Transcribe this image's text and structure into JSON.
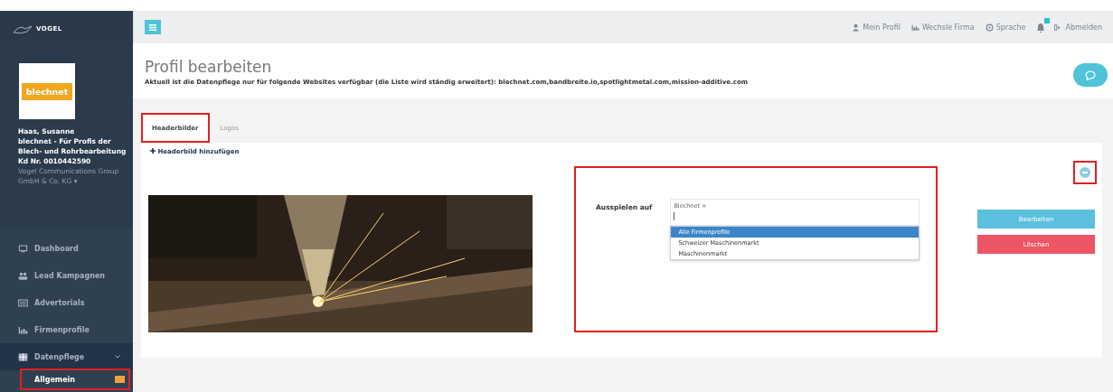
{
  "sidebar": {
    "logo": "VOGEL",
    "company_logo": "blechnet",
    "user": "Haas, Susanne",
    "company": "blechnet - Für Profis der Blech- und Rohrbearbeitung",
    "customer_number": "Kd Nr. 0010442590",
    "group": "Vogel Communications Group GmbH & Co. KG ▾",
    "items": [
      {
        "label": "Dashboard",
        "expanded": false
      },
      {
        "label": "Lead Kampagnen",
        "expanded": false
      },
      {
        "label": "Advertorials",
        "expanded": false
      },
      {
        "label": "Firmenprofile",
        "expanded": false
      },
      {
        "label": "Datenpflege",
        "expanded": true,
        "children": [
          {
            "label": "Allgemein",
            "highlighted": true
          }
        ]
      }
    ]
  },
  "topbar": {
    "links": [
      {
        "label": "Mein Profil"
      },
      {
        "label": "Wechsle Firma"
      },
      {
        "label": "Sprache"
      },
      {
        "label": "Abmelden"
      }
    ]
  },
  "page": {
    "title": "Profil bearbeiten",
    "notice": "Aktuell ist die Datenpflege nur für folgende Websites verfügbar (die Liste wird ständig erweitert): blechnet.com,bandbreite.io,spotlightmetal.com,mission-additive.com",
    "tabs": [
      {
        "label": "Headerbilder",
        "selected": true,
        "highlighted": true
      },
      {
        "label": "Logos",
        "selected": false,
        "highlighted": false
      }
    ],
    "add_link": "Headerbild hinzufügen",
    "header_image": {
      "kind": "picture",
      "play_on_label": "Ausspielen auf",
      "tags": [
        {
          "label": "Blechnet",
          "remove": "×"
        }
      ],
      "options": [
        {
          "label": "Alle Firmenprofile",
          "selected": true
        },
        {
          "label": "Schweizer Maschinenmarkt",
          "selected": false
        },
        {
          "label": "Maschinenmarkt",
          "selected": false
        }
      ],
      "buttons": [
        {
          "label": "Bearbeiten",
          "kind": "primary"
        },
        {
          "label": "Löschen",
          "kind": "danger"
        }
      ]
    }
  }
}
